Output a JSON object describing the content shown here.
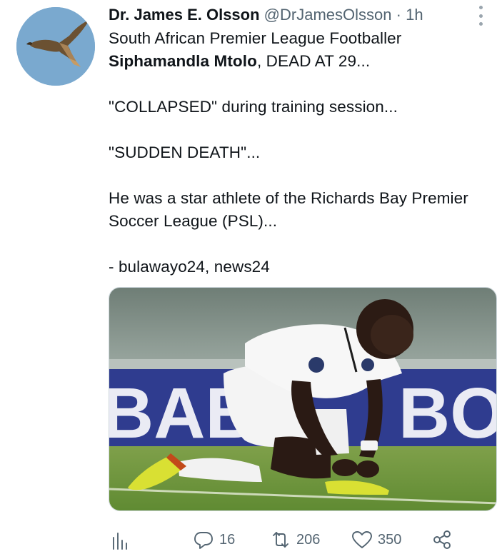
{
  "author": {
    "name": "Dr. James E. Olsson",
    "handle": "@DrJamesOlsson",
    "separator": "·",
    "time": "1h",
    "avatar_icon": "hawk-avatar-icon"
  },
  "tweet": {
    "line1": "South African Premier League Footballer",
    "line2_bold": "Siphamandla Mtolo",
    "line2_rest": ", DEAD AT 29...",
    "line3": "\"COLLAPSED\" during training session...",
    "line4": "\"SUDDEN DEATH\"...",
    "line5": "He was a star athlete of the Richards Bay Premier",
    "line6": "Soccer League (PSL)...",
    "line7": "- bulawayo24, news24"
  },
  "media": {
    "description_icon": "footballer-tying-boot-photo",
    "billboard_text_left": "BAB",
    "billboard_text_right": "BO"
  },
  "actions": {
    "views_icon": "analytics-icon",
    "replies": "16",
    "retweets": "206",
    "likes": "350",
    "share_icon": "share-icon"
  },
  "colors": {
    "text": "#0f1419",
    "secondary": "#536471",
    "border": "#cfd9de",
    "billboard": "#2f3c8f"
  }
}
